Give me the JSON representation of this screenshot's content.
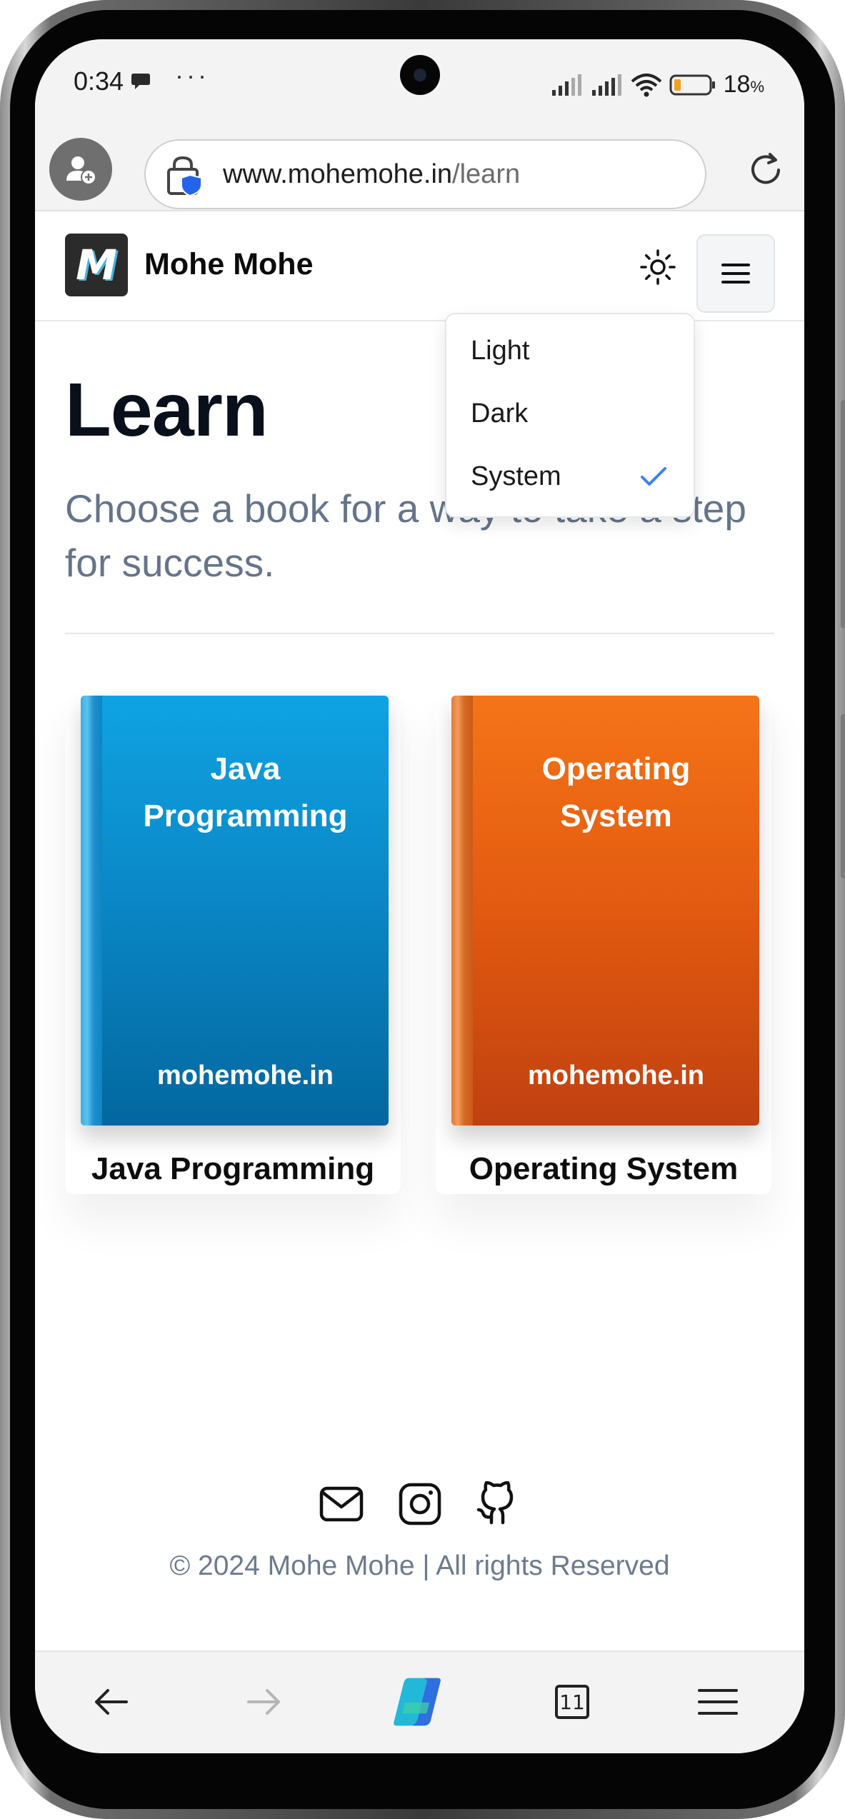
{
  "status_bar": {
    "time": "0:34",
    "dots": "···",
    "battery_percent": "18",
    "battery_unit": "%"
  },
  "browser": {
    "url_host": "www.mohemohe.in",
    "url_path": "/learn",
    "open_tabs": "11"
  },
  "site": {
    "logo_letter": "M",
    "brand": "Mohe Mohe"
  },
  "theme_menu": {
    "options": [
      "Light",
      "Dark",
      "System"
    ],
    "selected": "System"
  },
  "page": {
    "title": "Learn",
    "lead": "Choose a book for a way to take a step for success."
  },
  "books": [
    {
      "cover_line1": "Java",
      "cover_line2": "Programming",
      "cover_site": "mohemohe.in",
      "caption": "Java Programming"
    },
    {
      "cover_line1": "Operating",
      "cover_line2": "System",
      "cover_site": "mohemohe.in",
      "caption": "Operating System"
    }
  ],
  "footer": {
    "copyright": "© 2024 Mohe Mohe | All rights Reserved",
    "icons": [
      "mail-icon",
      "instagram-icon",
      "github-icon"
    ]
  },
  "colors": {
    "java_cover": "#0a85c4",
    "os_cover": "#e25a10",
    "check": "#3b82f6",
    "lead_text": "#66748a"
  }
}
